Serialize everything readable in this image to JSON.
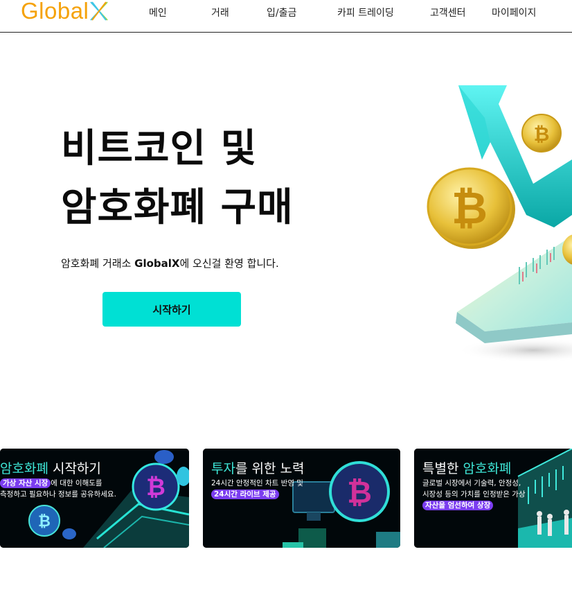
{
  "brand": {
    "logo_text": "Global",
    "logo_mark": "X",
    "colors": {
      "logo_orange": "#f5a20a",
      "accent_cyan": "#00e0d4",
      "highlight_purple": "#7b3df0"
    }
  },
  "nav": {
    "items": [
      {
        "label": "메인"
      },
      {
        "label": "거래"
      },
      {
        "label": "입/출금"
      },
      {
        "label": "카피 트레이딩"
      },
      {
        "label": "고객센터"
      },
      {
        "label": "마이페이지"
      }
    ]
  },
  "hero": {
    "title_line1": "비트코인 및",
    "title_line2": "암호화폐 구매",
    "subtitle_prefix": "암호화폐 거래소 ",
    "subtitle_brand": "GlobalX",
    "subtitle_suffix": "에 오신걸 환영 합니다.",
    "cta_label": "시작하기",
    "illustration_icon": "bitcoin-coins-rising-arrow-icon"
  },
  "cards": [
    {
      "title_highlight": "암호화폐",
      "title_rest": " 시작하기",
      "line1_pill": "가상 자산 시장",
      "line1_text": "에 대한 이해도를",
      "line2_text": "측정하고 필요하나 정보를 공유하세요.",
      "icon": "bitcoin-coins-icon"
    },
    {
      "title_highlight": "투자",
      "title_rest": "를 위한 노력",
      "line1_text": "24시간 안정적인 차트 반영 및",
      "line2_pill": "24시간 라이브 제공",
      "icon": "bitcoin-monitor-icon"
    },
    {
      "title_prefix": "특별한 ",
      "title_highlight": "암호화폐",
      "line1_text": "글로벌 시장에서 기술력, 안정성,",
      "line2_text": "시장성 등의 가치를 인정받은 가상",
      "line3_pill": "자산을 엄선하여 상장",
      "icon": "trading-people-icon"
    }
  ]
}
